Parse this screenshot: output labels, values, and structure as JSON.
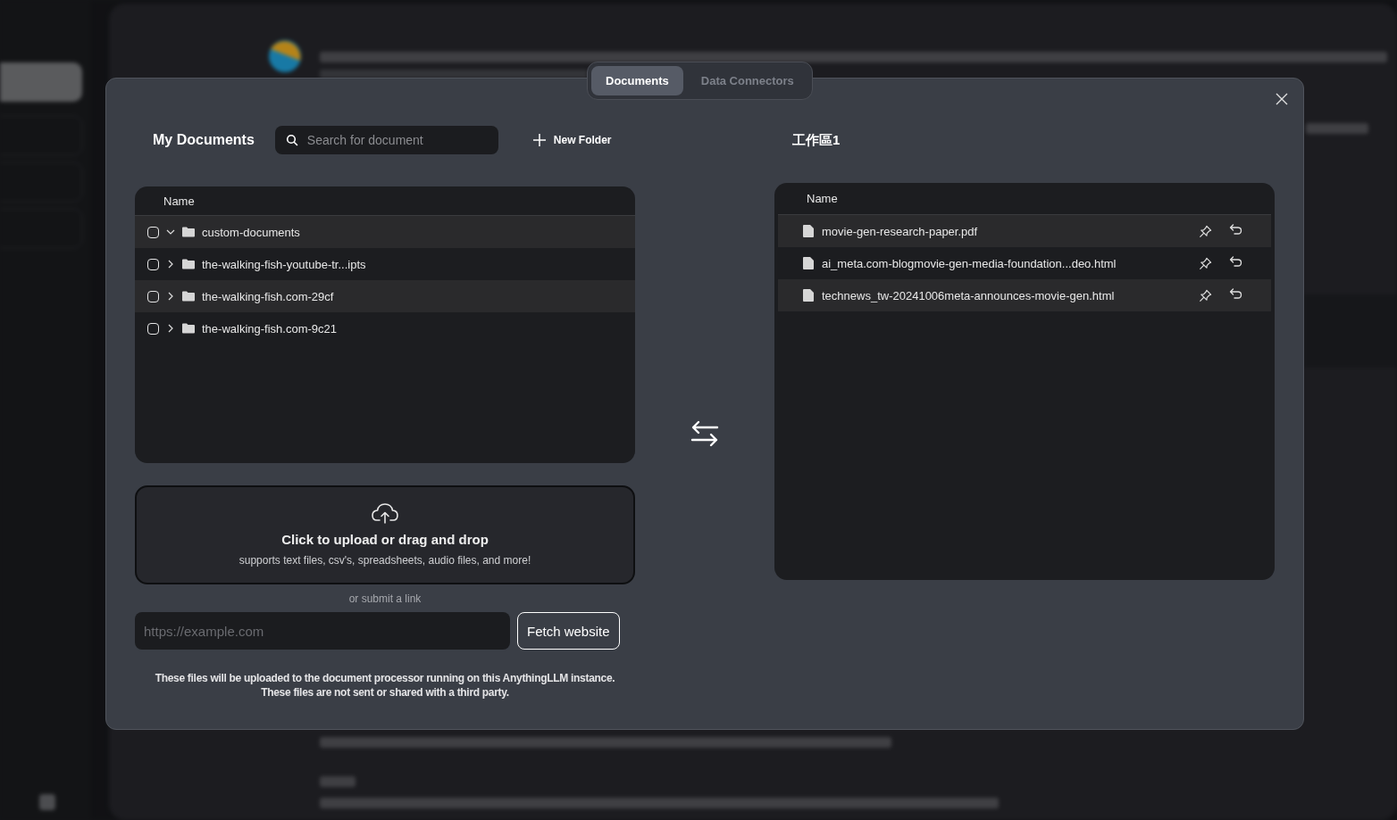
{
  "tabs": [
    {
      "label": "Documents",
      "selected": true
    },
    {
      "label": "Data Connectors",
      "selected": false
    }
  ],
  "my_documents": {
    "title": "My Documents",
    "search": {
      "placeholder": "Search for document"
    },
    "new_folder_button": "New Folder",
    "table": {
      "columns": [
        "Name"
      ],
      "rows": [
        {
          "name": "custom-documents",
          "checked": false,
          "expanded": true
        },
        {
          "name": "the-walking-fish-youtube-tr...ipts",
          "checked": false,
          "expanded": false
        },
        {
          "name": "the-walking-fish.com-29cf",
          "checked": false,
          "expanded": false
        },
        {
          "name": "the-walking-fish.com-9c21",
          "checked": false,
          "expanded": false
        }
      ]
    }
  },
  "upload": {
    "title": "Click to upload or drag and drop",
    "subtitle": "supports text files, csv's, spreadsheets, audio files, and more!"
  },
  "link": {
    "label": "or submit a link",
    "url_field": {
      "placeholder": "https://example.com"
    },
    "fetch_button": "Fetch website"
  },
  "note": [
    "These files will be uploaded to the document processor running on this AnythingLLM instance.",
    "These files are not sent or shared with a third party."
  ],
  "workspace": {
    "title": "工作區1",
    "table": {
      "columns": [
        "Name"
      ],
      "rows": [
        {
          "name": "movie-gen-research-paper.pdf"
        },
        {
          "name": "ai_meta.com-blogmovie-gen-media-foundation...deo.html"
        },
        {
          "name": "technews_tw-20241006meta-announces-movie-gen.html"
        }
      ]
    }
  }
}
